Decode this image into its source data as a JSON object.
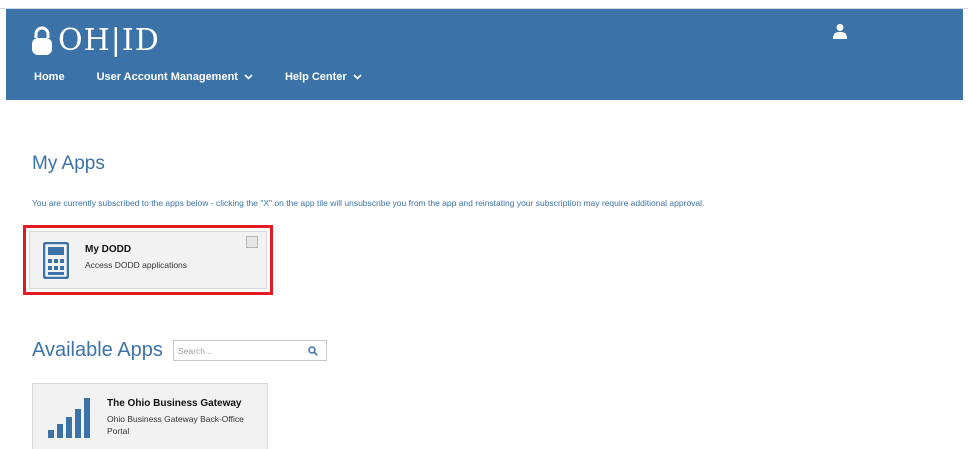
{
  "brand": {
    "logo_text": "OH|ID",
    "header_color": "#3b73a8"
  },
  "nav": {
    "home": "Home",
    "user_account_management": "User Account Management",
    "help_center": "Help Center"
  },
  "my_apps": {
    "title": "My Apps",
    "note": "You are currently subscribed to the apps below - clicking the \"X\" on the app tile will unsubscribe you from the app and reinstating your subscription may require additional approval.",
    "tiles": [
      {
        "title": "My DODD",
        "description": "Access DODD applications",
        "icon": "calculator-icon"
      }
    ],
    "highlight_color": "#e11c24"
  },
  "available_apps": {
    "title": "Available Apps",
    "search_placeholder": "Search...",
    "tiles": [
      {
        "title": "The Ohio Business Gateway",
        "description": "Ohio Business Gateway Back-Office Portal",
        "icon": "signal-bars-icon"
      }
    ]
  }
}
